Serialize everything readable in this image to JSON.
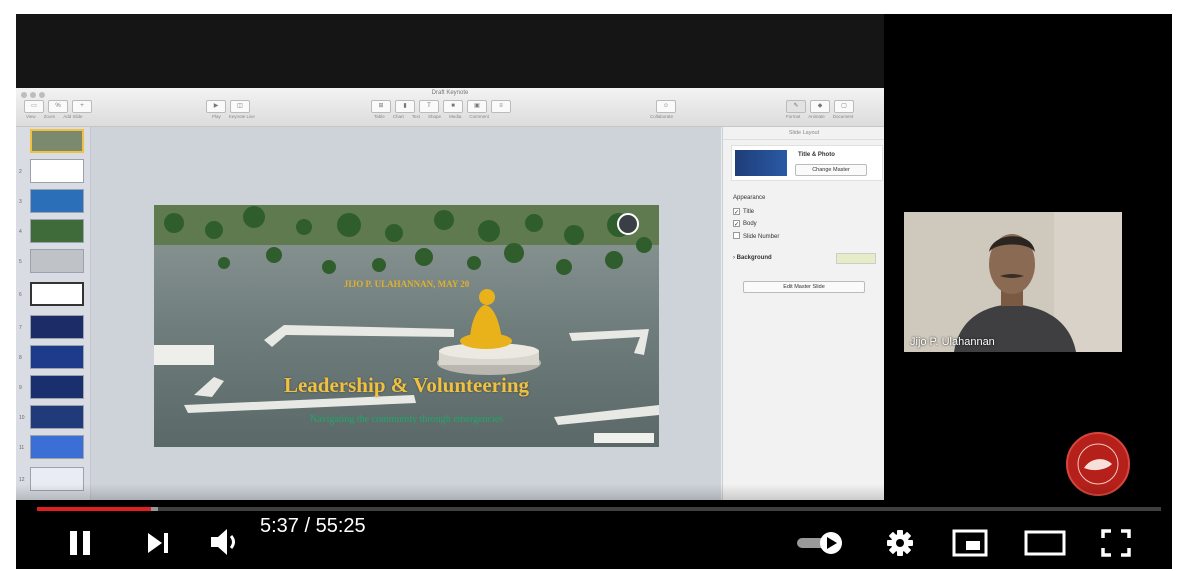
{
  "app": {
    "document_title": "Draft Keynote"
  },
  "toolbar": {
    "left_labels": [
      "View",
      "Zoom",
      "Add Slide"
    ],
    "mid_labels": [
      "Play",
      "Keynote Live"
    ],
    "insert_labels": [
      "Table",
      "Chart",
      "Text",
      "Shape",
      "Media",
      "Comment"
    ],
    "collab_label": "Collaborate",
    "right_labels": [
      "Format",
      "Animate",
      "Document"
    ]
  },
  "navigator": {
    "slide_count": 13
  },
  "slide": {
    "credit": "JIJO P. ULAHANNAN, MAY 20",
    "title": "Leadership & Volunteering",
    "subtitle": "Navigating the community through emergencies"
  },
  "inspector": {
    "header": "Slide Layout",
    "master_name": "Title & Photo",
    "change_master": "Change Master",
    "appearance_label": "Appearance",
    "check_title": "Title",
    "check_body": "Body",
    "check_slide_number": "Slide Number",
    "background_label": "Background",
    "edit_master": "Edit Master Slide"
  },
  "webcam": {
    "name": "Jijo P. Ulahannan"
  },
  "player": {
    "current_time": "5:37",
    "duration": "55:25",
    "time_display": "5:37 / 55:25",
    "progress_fraction": 0.101,
    "buffered_fraction": 0.108,
    "accent_color": "#e02020"
  },
  "icons": [
    "pause-icon",
    "next-icon",
    "volume-icon",
    "autoplay-toggle-icon",
    "settings-icon",
    "miniplayer-icon",
    "theater-icon",
    "fullscreen-icon"
  ]
}
